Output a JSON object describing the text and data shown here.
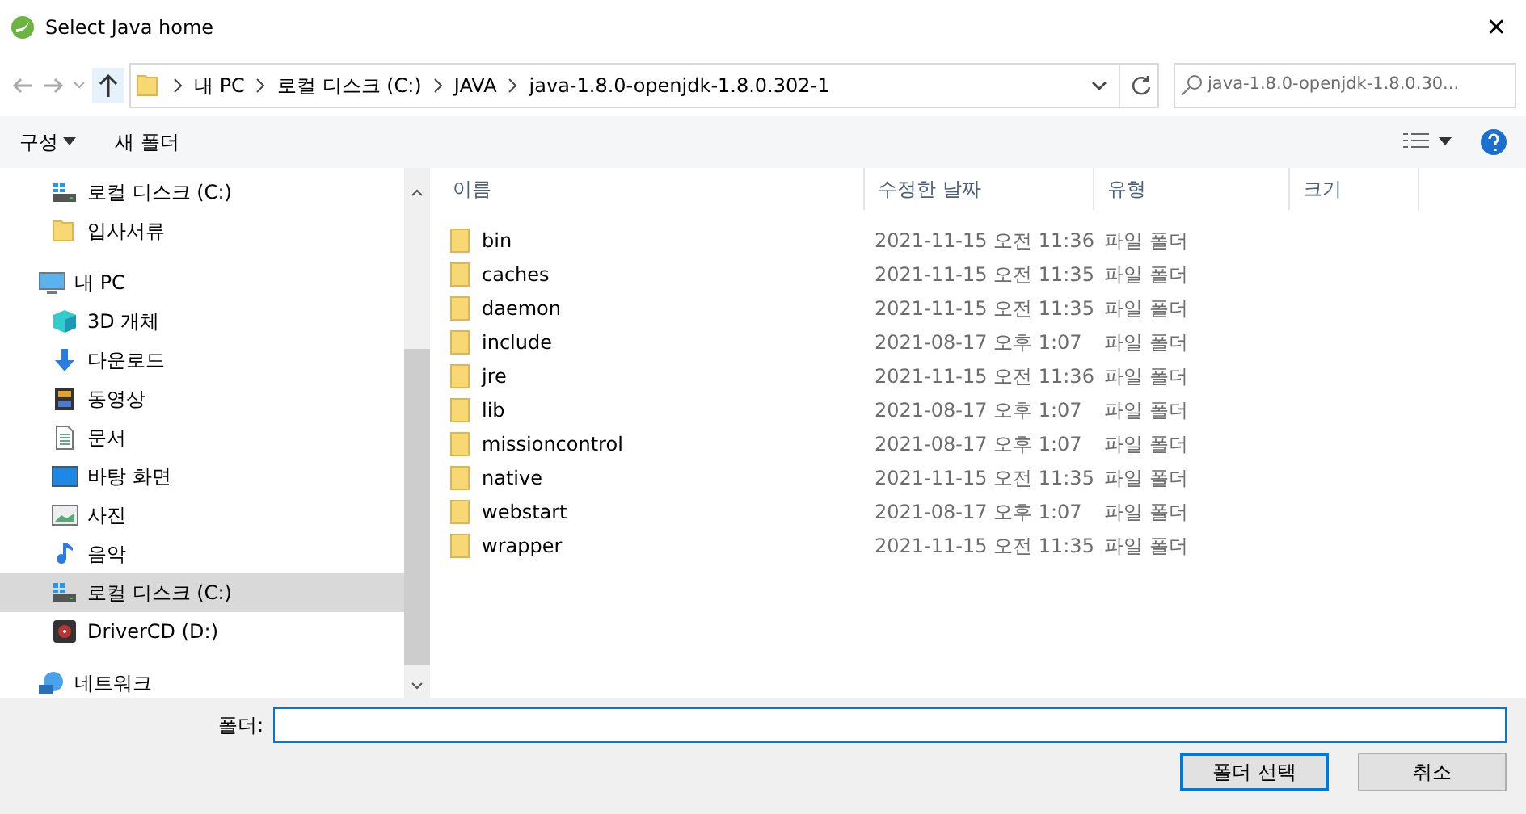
{
  "window": {
    "title": "Select Java home",
    "close": "✕"
  },
  "address_bar": {
    "path": [
      {
        "label": "내 PC"
      },
      {
        "label": "로컬 디스크 (C:)"
      },
      {
        "label": "JAVA"
      },
      {
        "label": "java-1.8.0-openjdk-1.8.0.302-1"
      }
    ],
    "search_placeholder": "java-1.8.0-openjdk-1.8.0.30..."
  },
  "toolbar": {
    "organize": "구성",
    "new_folder": "새 폴더"
  },
  "sidebar": {
    "quick_access_children": [
      {
        "label": "로컬 디스크 (C:)",
        "kind": "drive",
        "selected": false
      },
      {
        "label": "입사서류",
        "kind": "folder",
        "selected": false
      }
    ],
    "items": [
      {
        "label": "내 PC",
        "kind": "pc",
        "selected": false,
        "children": [
          {
            "label": "3D 개체",
            "kind": "cube",
            "selected": false
          },
          {
            "label": "다운로드",
            "kind": "download",
            "selected": false
          },
          {
            "label": "동영상",
            "kind": "video",
            "selected": false
          },
          {
            "label": "문서",
            "kind": "document",
            "selected": false
          },
          {
            "label": "바탕 화면",
            "kind": "desktop",
            "selected": false
          },
          {
            "label": "사진",
            "kind": "picture",
            "selected": false
          },
          {
            "label": "음악",
            "kind": "music",
            "selected": false
          },
          {
            "label": "로컬 디스크 (C:)",
            "kind": "drive",
            "selected": true
          },
          {
            "label": "DriverCD (D:)",
            "kind": "disc",
            "selected": false
          }
        ]
      },
      {
        "label": "네트워크",
        "kind": "network",
        "selected": false
      }
    ]
  },
  "file_list": {
    "columns": [
      "이름",
      "수정한 날짜",
      "유형",
      "크기"
    ],
    "rows": [
      {
        "name": "bin",
        "modified": "2021-11-15 오전 11:36",
        "type": "파일 폴더"
      },
      {
        "name": "caches",
        "modified": "2021-11-15 오전 11:35",
        "type": "파일 폴더"
      },
      {
        "name": "daemon",
        "modified": "2021-11-15 오전 11:35",
        "type": "파일 폴더"
      },
      {
        "name": "include",
        "modified": "2021-08-17 오후 1:07",
        "type": "파일 폴더"
      },
      {
        "name": "jre",
        "modified": "2021-11-15 오전 11:36",
        "type": "파일 폴더"
      },
      {
        "name": "lib",
        "modified": "2021-08-17 오후 1:07",
        "type": "파일 폴더"
      },
      {
        "name": "missioncontrol",
        "modified": "2021-08-17 오후 1:07",
        "type": "파일 폴더"
      },
      {
        "name": "native",
        "modified": "2021-11-15 오전 11:35",
        "type": "파일 폴더"
      },
      {
        "name": "webstart",
        "modified": "2021-08-17 오후 1:07",
        "type": "파일 폴더"
      },
      {
        "name": "wrapper",
        "modified": "2021-11-15 오전 11:35",
        "type": "파일 폴더"
      }
    ]
  },
  "footer": {
    "folder_label": "폴더:",
    "buttons": [
      {
        "label": "폴더 선택",
        "kind": "primary"
      },
      {
        "label": "취소",
        "kind": "secondary"
      }
    ]
  }
}
